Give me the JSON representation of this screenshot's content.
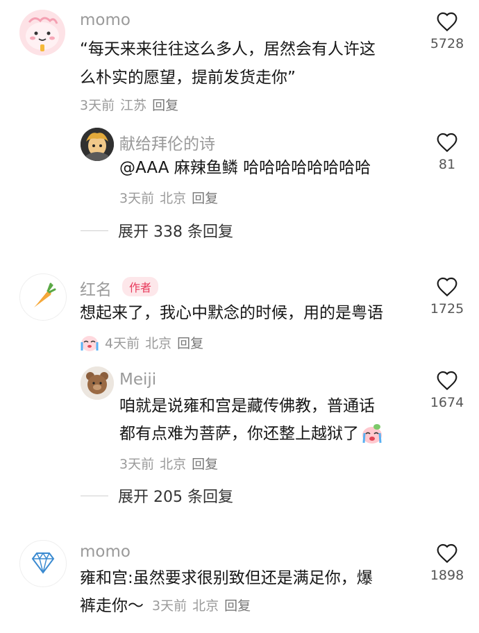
{
  "comments": [
    {
      "user": "momo",
      "lines": [
        "“每天来来往往这么多人，居然会有人许这",
        "么朴实的愿望，提前发货走你”"
      ],
      "meta": {
        "time": "3天前",
        "location": "江苏",
        "reply": "回复"
      },
      "likes": "5728",
      "reply_item": {
        "user": "献给拜伦的诗",
        "mention": "@AAA 麻辣鱼鳞",
        "text": " 哈哈哈哈哈哈哈哈",
        "meta": {
          "time": "3天前",
          "location": "北京",
          "reply": "回复"
        },
        "likes": "81"
      },
      "expand": "展开 338 条回复"
    },
    {
      "user": "红名",
      "badge": "作者",
      "lines": [
        "想起来了，我心中默念的时候，用的是粤语"
      ],
      "meta": {
        "time": "4天前",
        "location": "北京",
        "reply": "回复"
      },
      "likes": "1725",
      "reply_item": {
        "user": "Meiji",
        "lines": [
          "咱就是说雍和宫是藏传佛教，普通话",
          "都有点难为菩萨，你还整上越狱了"
        ],
        "meta": {
          "time": "3天前",
          "location": "北京",
          "reply": "回复"
        },
        "likes": "1674"
      },
      "expand": "展开 205 条回复"
    },
    {
      "user": "momo",
      "lines": [
        "雍和宫:虽然要求很别致但还是满足你，爆",
        "裤走你～"
      ],
      "meta": {
        "time": "3天前",
        "location": "北京",
        "reply": "回复"
      },
      "likes": "1898"
    }
  ]
}
